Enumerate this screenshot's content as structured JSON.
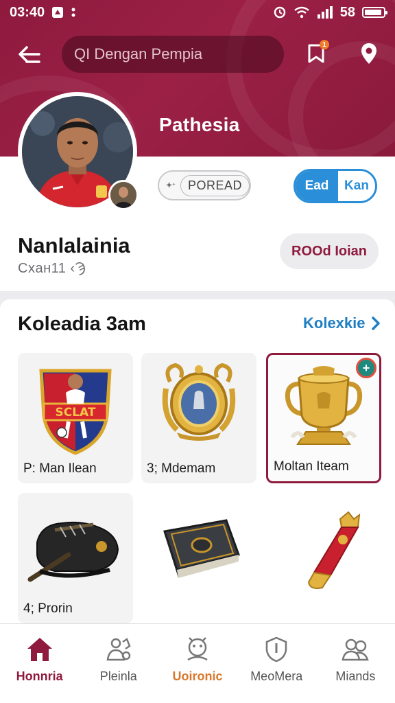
{
  "status_bar": {
    "time": "03:40",
    "battery_text": "58"
  },
  "header": {
    "search_placeholder": "QI Dengan Pempia",
    "title": "Pathesia",
    "notification_count": "1",
    "brand_color": "#8e1a3e"
  },
  "profile": {
    "outline_button": "POREAD",
    "toggle_on": "Ead",
    "toggle_off": "Kan",
    "name": "Nanlalainia",
    "subtitle": "Cxaн11 ‹Ϡ",
    "action_button": "ROOd Ioian"
  },
  "collection": {
    "title": "Koleadia 3am",
    "link": "Kolexkie",
    "items": [
      {
        "label": "P: Man Ilean",
        "icon": "club-crest-icon"
      },
      {
        "label": "3; Mdemam",
        "icon": "gold-shield-icon"
      },
      {
        "label": "Moltan Iteam",
        "icon": "gold-trophy-icon",
        "selected": true,
        "badge": "+"
      },
      {
        "label": "4; Prorin",
        "icon": "football-boot-icon"
      },
      {
        "label": "",
        "icon": "leather-book-icon"
      },
      {
        "label": "",
        "icon": "ribbon-medal-icon"
      }
    ]
  },
  "nav": {
    "items": [
      {
        "label": "Honnria",
        "icon": "home-icon"
      },
      {
        "label": "Pleinla",
        "icon": "people-icon"
      },
      {
        "label": "Uoironic",
        "icon": "mascot-icon"
      },
      {
        "label": "MeoMera",
        "icon": "shield-icon"
      },
      {
        "label": "Miands",
        "icon": "friends-icon"
      }
    ]
  }
}
